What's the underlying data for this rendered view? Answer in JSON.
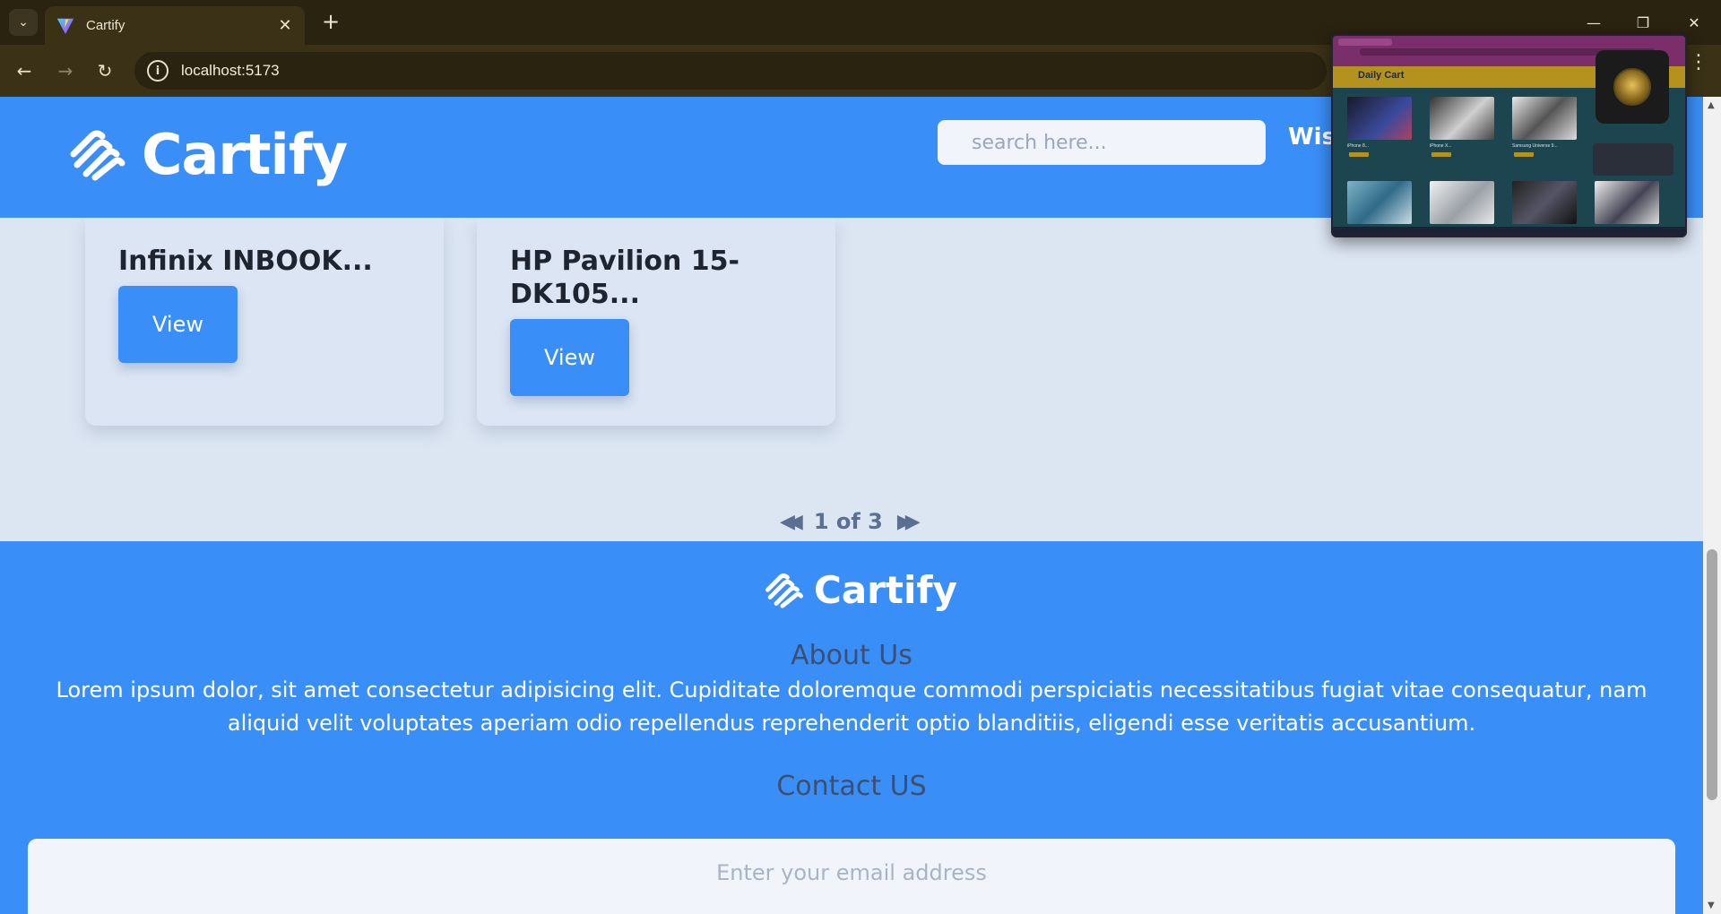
{
  "browser": {
    "tab_title": "Cartify",
    "url": "localhost:5173",
    "tab_close": "✕",
    "new_tab": "+",
    "back": "←",
    "forward": "→",
    "reload": "↻",
    "minimize": "—",
    "restore": "❐",
    "close": "✕",
    "menu": "⋮"
  },
  "header": {
    "logo_text": "Cartify",
    "search_placeholder": "search here...",
    "nav_partial": "Wis"
  },
  "products": [
    {
      "title": "Infinix INBOOK...",
      "button": "View"
    },
    {
      "title": "HP Pavilion 15-DK105...",
      "button": "View"
    }
  ],
  "pagination": {
    "prev": "◀◀",
    "label": "1 of 3",
    "next": "▶▶"
  },
  "footer": {
    "logo_text": "Cartify",
    "about_heading": "About Us",
    "about_text": "Lorem ipsum dolor, sit amet consectetur adipisicing elit. Cupiditate doloremque commodi perspiciatis necessitatibus fugiat vitae consequatur, nam aliquid velit voluptates aperiam odio repellendus reprehenderit optio blanditiis, eligendi esse veritatis accusantium.",
    "contact_heading": "Contact US",
    "email_placeholder": "Enter your email address"
  },
  "screen_share_preview": {
    "brand": "Daily Cart",
    "items": [
      "iPhone 8...",
      "iPhone X...",
      "Samsung Universe 9...",
      "",
      "",
      "",
      "",
      ""
    ]
  },
  "colors": {
    "brand_blue": "#3a8ef7",
    "page_bg": "#dce6f3",
    "chrome_dark": "#2a2310",
    "chrome_mid": "#3a3116"
  },
  "icons": {
    "logo": "cartify-logo-icon",
    "info": "site-info-icon",
    "tab_list": "chevron-down-icon"
  }
}
